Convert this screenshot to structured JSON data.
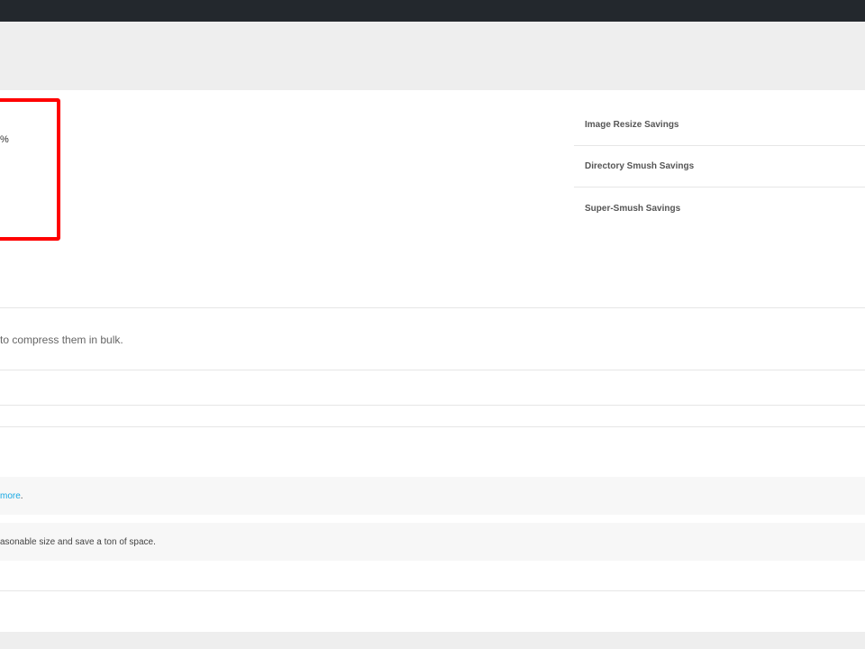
{
  "stats": {
    "percent_fragment": "%",
    "savings": [
      {
        "label": "Image Resize Savings"
      },
      {
        "label": "Directory Smush Savings"
      },
      {
        "label": "Super-Smush Savings"
      }
    ]
  },
  "bulk": {
    "description_fragment": "to compress them in bulk.",
    "notice_more_link": "more",
    "notice_more_suffix": ".",
    "notice_resize_text": "asonable size and save a ton of space."
  },
  "colors": {
    "topbar": "#23282d",
    "highlight": "#ff0000",
    "link": "#17a8e3"
  }
}
